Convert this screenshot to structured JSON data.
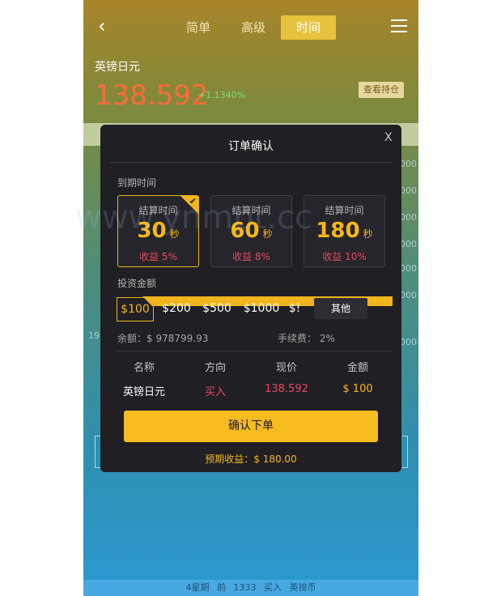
{
  "nav": {
    "tabs": [
      "简单",
      "高级",
      "时间"
    ]
  },
  "quote": {
    "asset_name": "英镑日元",
    "price": "138.592",
    "change": "+1.1340%",
    "holdings_label": "查看持仓"
  },
  "background": {
    "grid_labels": [
      "000",
      "000",
      "000",
      "000",
      "000",
      "000",
      "000"
    ],
    "left_edge_label": "19",
    "bottom_bar": [
      "4星期",
      "前",
      "1333",
      "买入",
      "英镑币"
    ]
  },
  "modal": {
    "title": "订单确认",
    "close": "X",
    "expiry_label": "到期时间",
    "time_options": [
      {
        "label": "结算时间",
        "seconds": "30",
        "unit": "秒",
        "rate": "收益 5%"
      },
      {
        "label": "结算时间",
        "seconds": "60",
        "unit": "秒",
        "rate": "收益 8%"
      },
      {
        "label": "结算时间",
        "seconds": "180",
        "unit": "秒",
        "rate": "收益 10%"
      }
    ],
    "amount_label": "投资金额",
    "amounts": [
      "$100",
      "$200",
      "$500",
      "$1000",
      "$!"
    ],
    "other_label": "其他",
    "balance": "余额：$ 978799.93",
    "fee": "手续费：  2%",
    "table_headers": [
      "名称",
      "方向",
      "现价",
      "金额"
    ],
    "order": {
      "name": "英镑日元",
      "direction": "买入",
      "price": "138.592",
      "amount": "$ 100"
    },
    "confirm_label": "确认下单",
    "expected": "预期收益：$ 180.00"
  },
  "watermark": "www.ynmpt.cc",
  "colors": {
    "accent": "#f6bb1f",
    "price_red": "#ff6b3b",
    "change_green": "#79e36d",
    "direction_red": "#e74a5d",
    "modal_bg": "#1f1f24"
  }
}
